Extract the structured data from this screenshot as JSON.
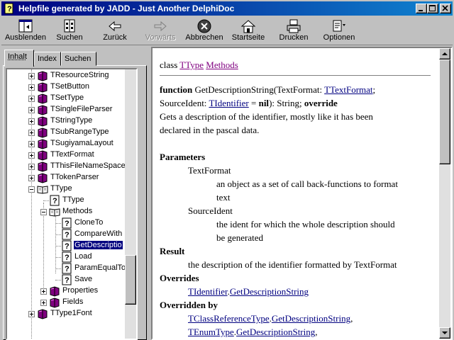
{
  "window": {
    "title": "Helpfile generated by JADD - Just Another DelphiDoc",
    "controls": [
      "minimize",
      "maximize",
      "close"
    ]
  },
  "toolbar": {
    "buttons": [
      {
        "label": "Ausblenden",
        "icon": "hide-panel-icon",
        "enabled": true
      },
      {
        "label": "Suchen",
        "icon": "find-icon",
        "enabled": true
      },
      {
        "label": "Zurück",
        "icon": "back-arrow-icon",
        "enabled": true
      },
      {
        "label": "Vorwärts",
        "icon": "forward-arrow-icon",
        "enabled": false
      },
      {
        "label": "Abbrechen",
        "icon": "stop-icon",
        "enabled": true
      },
      {
        "label": "Startseite",
        "icon": "home-icon",
        "enabled": true
      },
      {
        "label": "Drucken",
        "icon": "print-icon",
        "enabled": true
      },
      {
        "label": "Optionen",
        "icon": "options-icon",
        "enabled": true
      }
    ]
  },
  "tabs": [
    {
      "label": "Inhalt",
      "active": true
    },
    {
      "label": "Index",
      "active": false
    },
    {
      "label": "Suchen",
      "active": false
    }
  ],
  "tree": {
    "items": [
      {
        "label": "TResourceString",
        "icon": "book-closed-icon",
        "level": 0,
        "expander": "plus"
      },
      {
        "label": "TSetButton",
        "icon": "book-closed-icon",
        "level": 0,
        "expander": "plus"
      },
      {
        "label": "TSetType",
        "icon": "book-closed-icon",
        "level": 0,
        "expander": "plus"
      },
      {
        "label": "TSingleFileParser",
        "icon": "book-closed-icon",
        "level": 0,
        "expander": "plus"
      },
      {
        "label": "TStringType",
        "icon": "book-closed-icon",
        "level": 0,
        "expander": "plus"
      },
      {
        "label": "TSubRangeType",
        "icon": "book-closed-icon",
        "level": 0,
        "expander": "plus"
      },
      {
        "label": "TSugiyamaLayout",
        "icon": "book-closed-icon",
        "level": 0,
        "expander": "plus"
      },
      {
        "label": "TTextFormat",
        "icon": "book-closed-icon",
        "level": 0,
        "expander": "plus"
      },
      {
        "label": "TThisFileNameSpace",
        "icon": "book-closed-icon",
        "level": 0,
        "expander": "plus"
      },
      {
        "label": "TTokenParser",
        "icon": "book-closed-icon",
        "level": 0,
        "expander": "plus"
      },
      {
        "label": "TType",
        "icon": "book-open-icon",
        "level": 0,
        "expander": "minus"
      },
      {
        "label": "TType",
        "icon": "help-page-icon",
        "level": 1,
        "expander": "none"
      },
      {
        "label": "Methods",
        "icon": "book-open-icon",
        "level": 1,
        "expander": "minus"
      },
      {
        "label": "CloneTo",
        "icon": "help-page-icon",
        "level": 2,
        "expander": "none"
      },
      {
        "label": "CompareWith",
        "icon": "help-page-icon",
        "level": 2,
        "expander": "none"
      },
      {
        "label": "GetDescriptio",
        "icon": "help-page-icon",
        "level": 2,
        "expander": "none",
        "selected": true
      },
      {
        "label": "Load",
        "icon": "help-page-icon",
        "level": 2,
        "expander": "none"
      },
      {
        "label": "ParamEqualTo",
        "icon": "help-page-icon",
        "level": 2,
        "expander": "none"
      },
      {
        "label": "Save",
        "icon": "help-page-icon",
        "level": 2,
        "expander": "none"
      },
      {
        "label": "Properties",
        "icon": "book-closed-icon",
        "level": 1,
        "expander": "plus"
      },
      {
        "label": "Fields",
        "icon": "book-closed-icon",
        "level": 1,
        "expander": "plus"
      },
      {
        "label": "TType1Font",
        "icon": "book-closed-icon",
        "level": 0,
        "expander": "plus"
      }
    ]
  },
  "content": {
    "header": {
      "prefix": "class",
      "link1": "TType",
      "link2": "Methods"
    },
    "signature": {
      "keyword": "function",
      "name": "GetDescriptionString(TextFormat: ",
      "type1": "TTextFormat",
      "sep1": ";",
      "param2": "SourceIdent: ",
      "type2": "TIdentifier",
      "default_eq": " = ",
      "default_val": "nil",
      "ret": "): String; ",
      "directive": "override"
    },
    "description": [
      "Gets a description of the identifier, mostly like it has been",
      "declared in the pascal data."
    ],
    "parameters_heading": "Parameters",
    "param1_name": "TextFormat",
    "param1_desc": [
      "an object as a set of call back-functions to format",
      "text"
    ],
    "param2_name": "SourceIdent",
    "param2_desc": [
      "the ident for which the whole description should",
      "be generated"
    ],
    "result_heading": "Result",
    "result_text": "the description of the identifier formatted by TextFormat",
    "overrides_heading": "Overrides",
    "overrides_link1": "TIdentifier",
    "overrides_dot": ".",
    "overrides_link2": "GetDescriptionString",
    "overridden_heading": "Overridden by",
    "overridden": [
      {
        "cls": "TClassReferenceType",
        "dot": ".",
        "method": "GetDescriptionString",
        "sep": ","
      },
      {
        "cls": "TEnumType",
        "dot": ".",
        "method": "GetDescriptionString",
        "sep": ","
      }
    ]
  }
}
